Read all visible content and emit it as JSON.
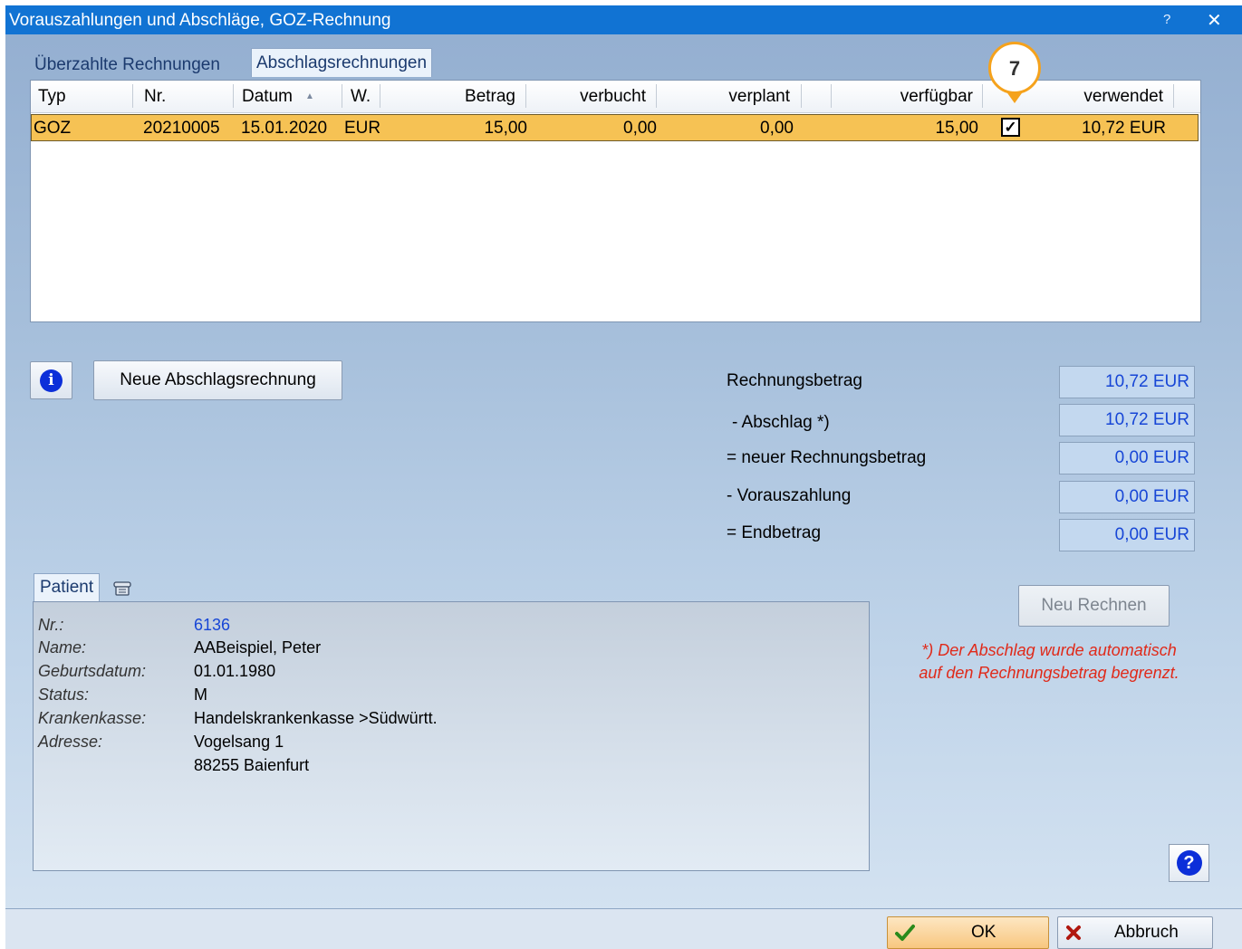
{
  "window": {
    "title": "Vorauszahlungen und Abschläge, GOZ-Rechnung",
    "help": "?",
    "close": "✕"
  },
  "tabs": [
    {
      "label": "Überzahlte Rechnungen"
    },
    {
      "label": "Abschlagsrechnungen"
    }
  ],
  "grid": {
    "columns": [
      "Typ",
      "Nr.",
      "Datum",
      "W.",
      "Betrag",
      "verbucht",
      "verplant",
      "verfügbar",
      "verwendet"
    ],
    "sort_indicator": "▲",
    "rows": [
      {
        "typ": "GOZ",
        "nr": "20210005",
        "datum": "15.01.2020",
        "w": "EUR",
        "betrag": "15,00",
        "verbucht": "0,00",
        "verplant": "0,00",
        "verfuegbar": "15,00",
        "checked": "✓",
        "verwendet": "10,72 EUR"
      }
    ]
  },
  "callout": {
    "number": "7"
  },
  "buttons": {
    "info": "i",
    "new_invoice": "Neue Abschlagsrechnung",
    "recalc": "Neu Rechnen",
    "help": "?",
    "ok": "OK",
    "cancel": "Abbruch"
  },
  "summary": [
    {
      "label": "Rechnungsbetrag",
      "value": "10,72 EUR"
    },
    {
      "label": "- Abschlag *)",
      "value": "10,72 EUR"
    },
    {
      "label": "= neuer Rechnungsbetrag",
      "value": "0,00 EUR"
    },
    {
      "label": "- Vorauszahlung",
      "value": "0,00 EUR"
    },
    {
      "label": "= Endbetrag",
      "value": "0,00 EUR"
    }
  ],
  "patient": {
    "tab": "Patient",
    "fields": [
      {
        "label": "Nr.:",
        "value": "6136"
      },
      {
        "label": "Name:",
        "value": "AABeispiel, Peter"
      },
      {
        "label": "Geburtsdatum:",
        "value": "01.01.1980"
      },
      {
        "label": "Status:",
        "value": "M"
      },
      {
        "label": "Krankenkasse:",
        "value": "Handelskrankenkasse >Südwürtt."
      },
      {
        "label": "Adresse:",
        "value": "Vogelsang 1"
      },
      {
        "label": "",
        "value": "88255 Baienfurt"
      }
    ]
  },
  "footnote": {
    "line1": "*) Der Abschlag wurde automatisch",
    "line2": "auf den Rechnungsbetrag begrenzt."
  },
  "colors": {
    "titlebar": "#1173d3",
    "selected_row": "#f6c254",
    "value_blue": "#1746d6",
    "footnote_red": "#e02a1a",
    "callout_orange": "#f5a21c"
  }
}
